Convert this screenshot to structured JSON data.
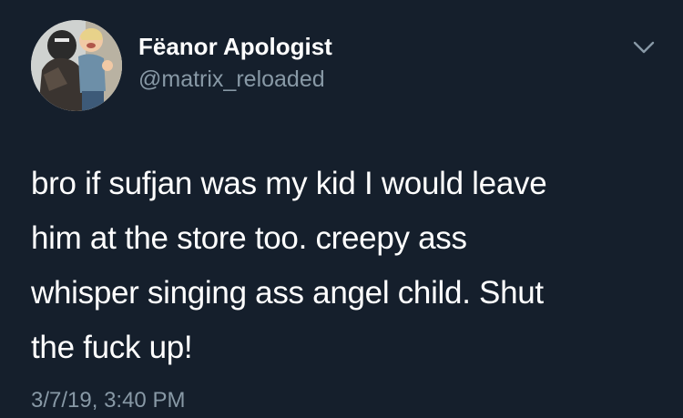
{
  "tweet": {
    "display_name": "Fëanor Apologist",
    "handle": "@matrix_reloaded",
    "body_lines": [
      "bro if sufjan was my kid I would leave",
      "him at the store too. creepy ass",
      "whisper singing ass angel child. Shut",
      "the fuck up!"
    ],
    "timestamp": "3/7/19, 3:40 PM"
  },
  "icons": {
    "avatar": "profile-photo",
    "menu": "chevron-down-icon"
  },
  "colors": {
    "background": "#151f2c",
    "primary_text": "#ffffff",
    "secondary_text": "#8899a6"
  }
}
